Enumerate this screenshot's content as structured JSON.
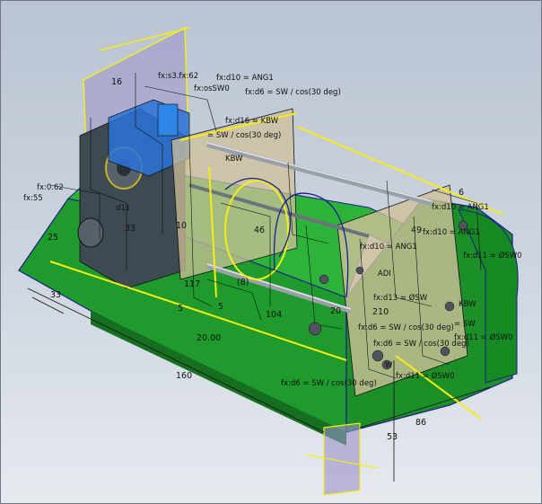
{
  "viewport": {
    "background_top": "#b9c3d2",
    "background_bottom": "#e6eaef",
    "colors": {
      "base_green": "#1f9a2c",
      "base_green_dark": "#166f20",
      "plate_tan": "#cfc09a",
      "sketch_yellow": "#f4ee15",
      "edge_navy": "#1b1f8a",
      "work_plane": "#9b93c9",
      "motor_blue": "#2a73d8"
    },
    "dimensions": {
      "d_160": "160",
      "d_86": "86",
      "d_53": "53",
      "d_20": "20.00",
      "d_117": "117",
      "d_104": "104",
      "d_46": "46",
      "d_49": "49",
      "d_33": "33",
      "d_25": "25",
      "d_16": "16",
      "d_6": "6",
      "d_5": "5",
      "d_5b": "5",
      "d_8": "(8)",
      "d_10": "10",
      "d_33b": "33",
      "d_20b": "20",
      "d_210": "210"
    },
    "equations": {
      "eq_ang1_top": "fx:d10 = ANG1",
      "eq_sw_cos_top": "fx:d6 = SW / cos(30 deg)",
      "eq_osw0_top": "fx:osSW0",
      "eq_kbw_top": "fx:d16 = KBW",
      "eq_sw_cos_mid": "= SW / cos(30 deg)",
      "eq_fx62": "fx:s3.fx:62",
      "eq_fx55": "fx:55",
      "eq_fx62b": "fx:0.62",
      "eq_d11": "d11",
      "eq_ang1_right": "fx:d10 = ANG1",
      "eq_osw0_right": "fx:d11 = ØSW0",
      "eq_ang1_r2": "fx:d10 = ANG1",
      "eq_adi": "ADI",
      "eq_osw_r": "fx:d13 = ØSW",
      "eq_cos_r": "fx:d6 = SW / cos(30 deg)",
      "eq_ang1_r3": "fx:d10 = ANG1",
      "eq_kbw_r": "KBW",
      "eq_sw_r": "= SW",
      "eq_osw0_r2": "fx:d11 = ØSW0",
      "eq_cos_r2": "fx:d6 = SW / cos(30 deg)",
      "eq_cos_bottom": "fx:d6 = SW / cos(30 deg)",
      "eq_osw0_bottom": "fx:d11 = ØSW0",
      "eq_w": "W",
      "eq_kbw_mid": "KBW"
    }
  }
}
